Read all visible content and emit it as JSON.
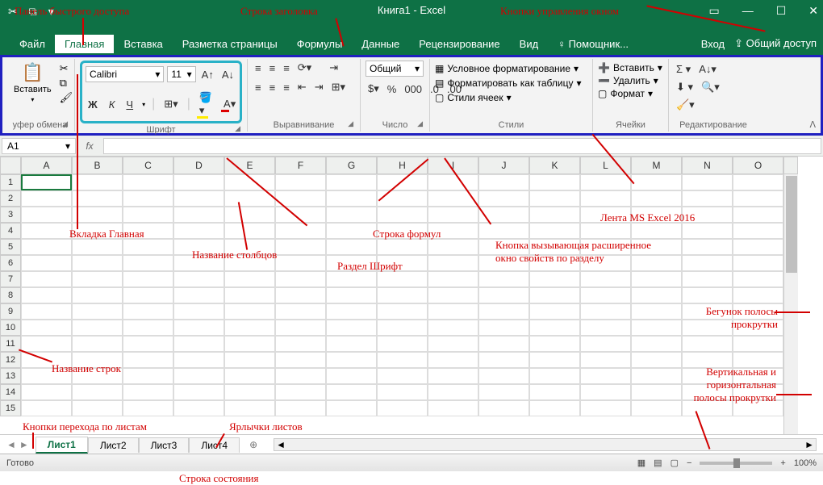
{
  "title": "Книга1 - Excel",
  "qat": {
    "cut": "✂",
    "copy": "⧉",
    "dd": "▾"
  },
  "winctl": {
    "ropts": "▭",
    "min": "—",
    "max": "☐",
    "close": "✕"
  },
  "tabs": {
    "file": "Файл",
    "home": "Главная",
    "insert": "Вставка",
    "layout": "Разметка страницы",
    "formulas": "Формулы",
    "data": "Данные",
    "review": "Рецензирование",
    "view": "Вид",
    "help": "Помощник...",
    "signin": "Вход",
    "share": "Общий доступ"
  },
  "ribbon": {
    "clipboard": {
      "paste": "Вставить",
      "label": "уфер обмена"
    },
    "font": {
      "name": "Calibri",
      "size": "11",
      "label": "Шрифт",
      "bold": "Ж",
      "italic": "К",
      "underline": "Ч"
    },
    "align": {
      "label": "Выравнивание"
    },
    "number": {
      "general": "Общий",
      "label": "Число"
    },
    "styles": {
      "cond": "Условное форматирование",
      "table": "Форматировать как таблицу",
      "cell": "Стили ячеек",
      "label": "Стили"
    },
    "cells": {
      "insert": "Вставить",
      "delete": "Удалить",
      "format": "Формат",
      "label": "Ячейки"
    },
    "editing": {
      "label": "Редактирование"
    }
  },
  "namebox": "A1",
  "columns": [
    "A",
    "B",
    "C",
    "D",
    "E",
    "F",
    "G",
    "H",
    "I",
    "J",
    "K",
    "L",
    "M",
    "N",
    "O"
  ],
  "rows": [
    "1",
    "2",
    "3",
    "4",
    "5",
    "6",
    "7",
    "8",
    "9",
    "10",
    "11",
    "12",
    "13",
    "14",
    "15"
  ],
  "sheets": {
    "s1": "Лист1",
    "s2": "Лист2",
    "s3": "Лист3",
    "s4": "Лист4",
    "add": "⊕"
  },
  "status": {
    "ready": "Готово",
    "zoom": "100%"
  },
  "annotations": {
    "qat": "Панель быстрого доступа",
    "title": "Строка заголовка",
    "winctl": "Кнопки управления окном",
    "hometab": "Вкладка Главная",
    "cols": "Название столбцов",
    "fbar": "Строка формул",
    "fontsec": "Раздел Шрифт",
    "launcher": "Кнопка вызывающая расширенное окно свойств по разделу",
    "ribbonlbl": "Лента MS Excel 2016",
    "rows": "Название строк",
    "sheetnav": "Кнопки перехода по листам",
    "sheettabs": "Ярлычки листов",
    "statusbar": "Строка состояния",
    "vthumb": "Бегунок полосы прокрутки",
    "scrolls": "Вертикальная и горизонтальная полосы прокрутки"
  }
}
